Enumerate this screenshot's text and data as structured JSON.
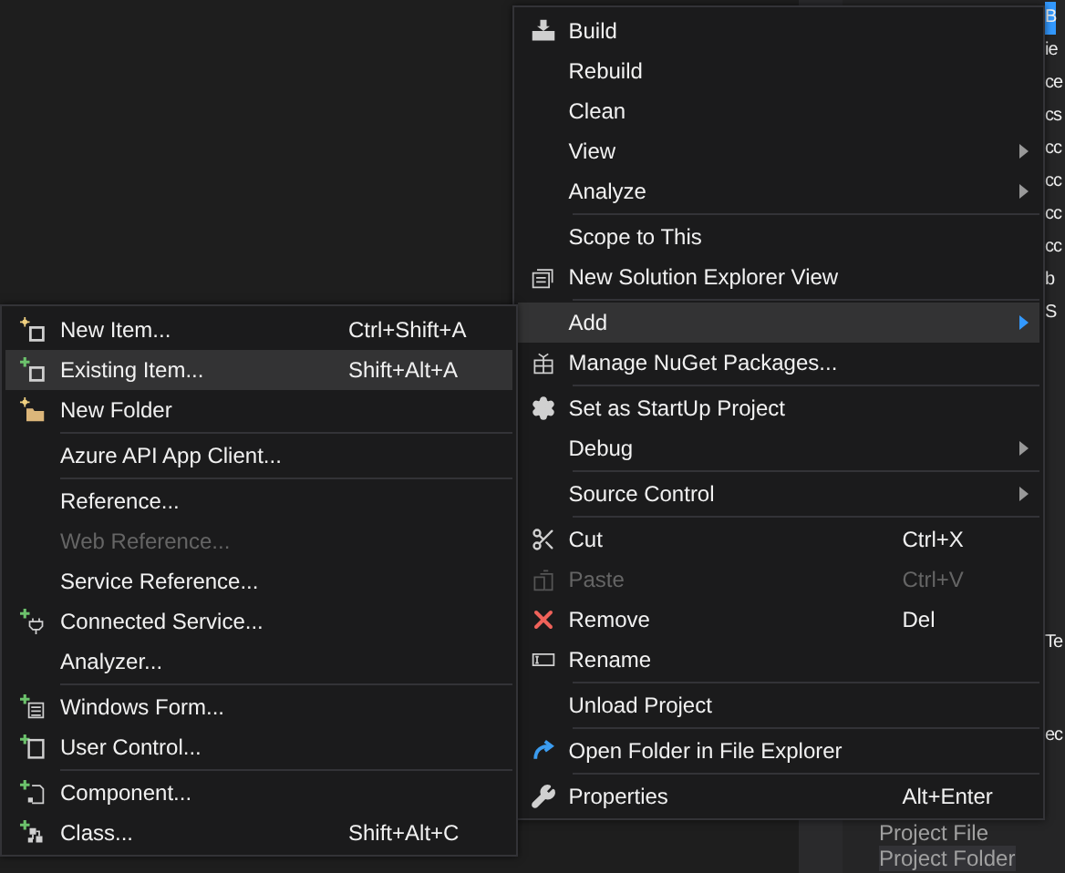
{
  "solution_explorer": {
    "rows": [
      {
        "text": "B",
        "selected": true
      },
      {
        "text": "ie",
        "selected": false
      },
      {
        "text": "ce",
        "selected": false
      },
      {
        "text": "cs",
        "selected": false
      },
      {
        "text": "cc",
        "selected": false
      },
      {
        "text": "cc",
        "selected": false
      },
      {
        "text": "cc",
        "selected": false
      },
      {
        "text": "cc",
        "selected": false
      },
      {
        "text": "b",
        "selected": false
      },
      {
        "text": "S",
        "selected": false
      }
    ],
    "lower_rows": [
      {
        "text": "Te",
        "selected": false
      },
      {
        "text": "ec",
        "selected": false
      }
    ],
    "bottom_rows": [
      {
        "text": "Project File",
        "selected": false
      },
      {
        "text": "Project Folder",
        "selected": true
      }
    ]
  },
  "context_menu": {
    "sections": [
      [
        {
          "label": "Build",
          "submenu": false,
          "selected": false,
          "disabled": false
        },
        {
          "label": "Rebuild",
          "submenu": false,
          "selected": false,
          "disabled": false
        },
        {
          "label": "Clean",
          "submenu": false,
          "selected": false,
          "disabled": false
        },
        {
          "label": "View",
          "submenu": true,
          "selected": false,
          "disabled": false
        },
        {
          "label": "Analyze",
          "submenu": true,
          "selected": false,
          "disabled": false
        }
      ],
      [
        {
          "label": "Scope to This",
          "submenu": false,
          "selected": false,
          "disabled": false
        },
        {
          "label": "New Solution Explorer View",
          "submenu": false,
          "selected": false,
          "disabled": false
        }
      ],
      [
        {
          "label": "Add",
          "submenu": true,
          "selected": true,
          "disabled": false
        },
        {
          "label": "Manage NuGet Packages...",
          "submenu": false,
          "selected": false,
          "disabled": false
        }
      ],
      [
        {
          "label": "Set as StartUp Project",
          "submenu": false,
          "selected": false,
          "disabled": false
        },
        {
          "label": "Debug",
          "submenu": true,
          "selected": false,
          "disabled": false
        }
      ],
      [
        {
          "label": "Source Control",
          "submenu": true,
          "selected": false,
          "disabled": false
        }
      ],
      [
        {
          "label": "Cut",
          "shortcut": "Ctrl+X",
          "submenu": false,
          "selected": false,
          "disabled": false
        },
        {
          "label": "Paste",
          "shortcut": "Ctrl+V",
          "submenu": false,
          "selected": false,
          "disabled": true
        },
        {
          "label": "Remove",
          "shortcut": "Del",
          "submenu": false,
          "selected": false,
          "disabled": false
        },
        {
          "label": "Rename",
          "submenu": false,
          "selected": false,
          "disabled": false
        }
      ],
      [
        {
          "label": "Unload Project",
          "submenu": false,
          "selected": false,
          "disabled": false
        }
      ],
      [
        {
          "label": "Open Folder in File Explorer",
          "submenu": false,
          "selected": false,
          "disabled": false
        }
      ],
      [
        {
          "label": "Properties",
          "shortcut": "Alt+Enter",
          "submenu": false,
          "selected": false,
          "disabled": false
        }
      ]
    ]
  },
  "add_submenu": {
    "sections": [
      [
        {
          "label": "New Item...",
          "shortcut": "Ctrl+Shift+A",
          "submenu": false,
          "selected": false,
          "disabled": false
        },
        {
          "label": "Existing Item...",
          "shortcut": "Shift+Alt+A",
          "submenu": false,
          "selected": true,
          "disabled": false
        },
        {
          "label": "New Folder",
          "submenu": false,
          "selected": false,
          "disabled": false
        }
      ],
      [
        {
          "label": "Azure API App Client...",
          "submenu": false,
          "selected": false,
          "disabled": false
        }
      ],
      [
        {
          "label": "Reference...",
          "submenu": false,
          "selected": false,
          "disabled": false
        },
        {
          "label": "Web Reference...",
          "submenu": false,
          "selected": false,
          "disabled": true
        },
        {
          "label": "Service Reference...",
          "submenu": false,
          "selected": false,
          "disabled": false
        },
        {
          "label": "Connected Service...",
          "submenu": false,
          "selected": false,
          "disabled": false
        },
        {
          "label": "Analyzer...",
          "submenu": false,
          "selected": false,
          "disabled": false
        }
      ],
      [
        {
          "label": "Windows Form...",
          "submenu": false,
          "selected": false,
          "disabled": false
        },
        {
          "label": "User Control...",
          "submenu": false,
          "selected": false,
          "disabled": false
        }
      ],
      [
        {
          "label": "Component...",
          "submenu": false,
          "selected": false,
          "disabled": false
        },
        {
          "label": "Class...",
          "shortcut": "Shift+Alt+C",
          "submenu": false,
          "selected": false,
          "disabled": false
        }
      ]
    ]
  }
}
